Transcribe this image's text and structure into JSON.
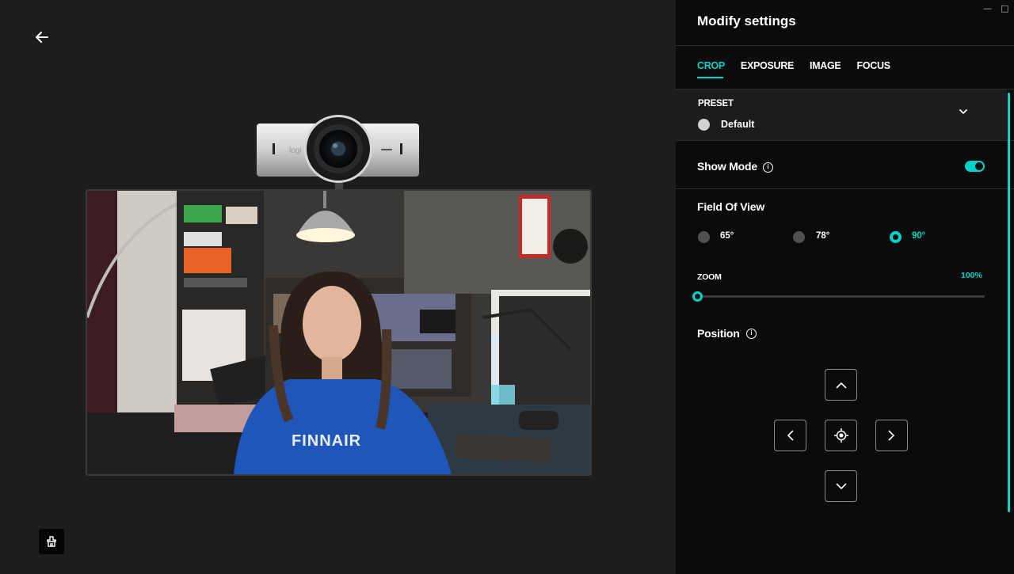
{
  "panel": {
    "title": "Modify settings",
    "tabs": [
      {
        "label": "CROP",
        "active": true
      },
      {
        "label": "EXPOSURE",
        "active": false
      },
      {
        "label": "IMAGE",
        "active": false
      },
      {
        "label": "FOCUS",
        "active": false
      }
    ],
    "preset": {
      "label": "PRESET",
      "value": "Default"
    },
    "show_mode": {
      "label": "Show Mode",
      "enabled": true
    },
    "field_of_view": {
      "label": "Field Of View",
      "options": [
        {
          "label": "65°",
          "selected": false
        },
        {
          "label": "78°",
          "selected": false
        },
        {
          "label": "90°",
          "selected": true
        }
      ]
    },
    "zoom": {
      "label": "ZOOM",
      "value": "100%"
    },
    "position": {
      "label": "Position"
    }
  },
  "webcam_logo": "logi",
  "preview_shirt_text": "FINNAIR",
  "colors": {
    "accent": "#00d3c8",
    "panel_bg": "#0b0b0b",
    "stage_bg": "#1d1d1d"
  }
}
